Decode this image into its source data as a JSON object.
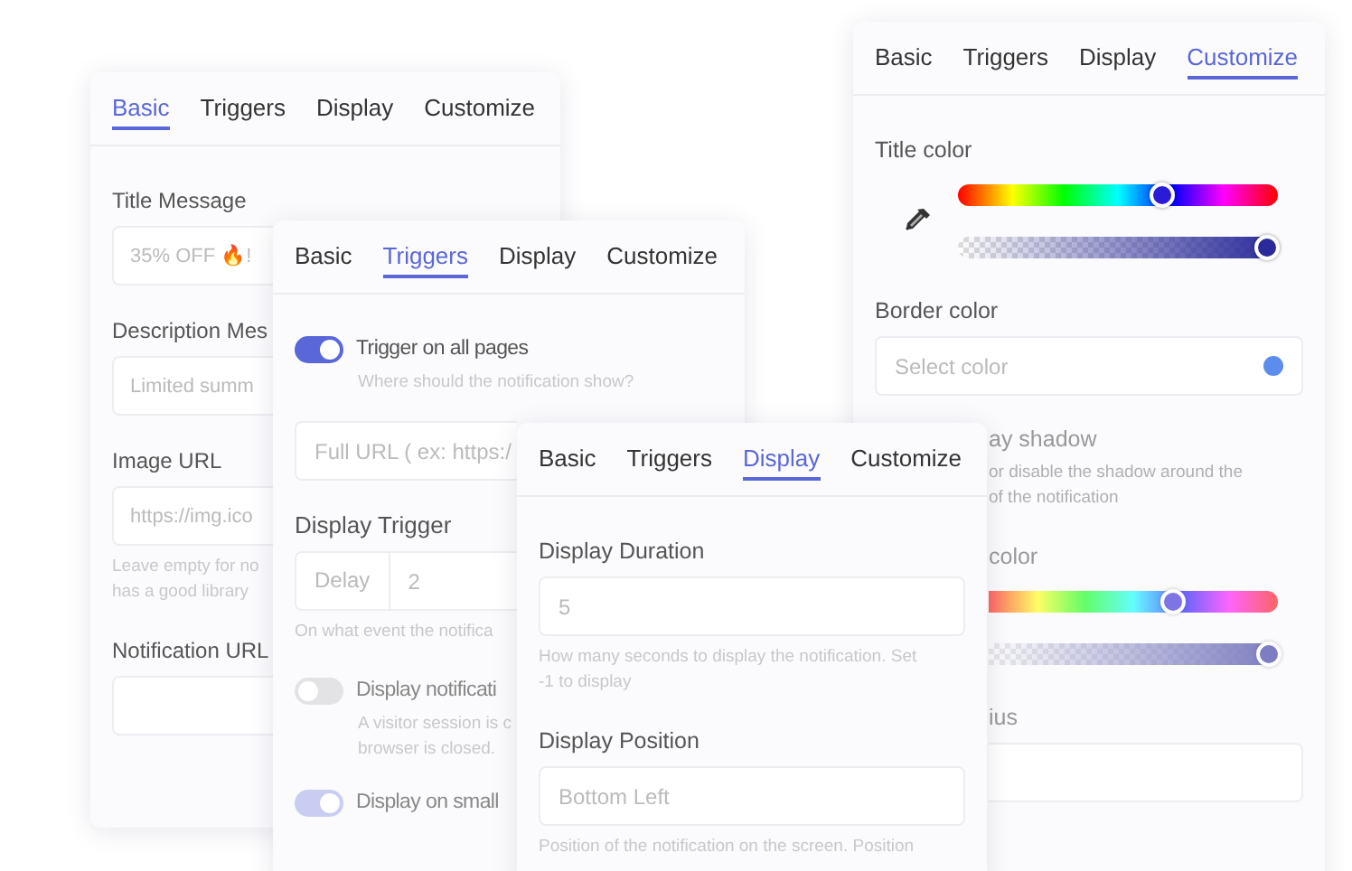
{
  "panels": [
    {
      "tabs": [
        {
          "label": "Basic",
          "selected": true
        },
        {
          "label": "Triggers",
          "selected": false
        },
        {
          "label": "Display",
          "selected": false
        },
        {
          "label": "Customize",
          "selected": false
        }
      ],
      "items": [
        {
          "kind": "field",
          "label": "Title Message",
          "value": "35% OFF 🔥!"
        },
        {
          "kind": "field",
          "label": "Description Mes",
          "placeholder": "Limited summ"
        },
        {
          "kind": "field",
          "label": "Image URL",
          "placeholder": "https://img.ico",
          "help": [
            "Leave empty for no",
            "has a good library"
          ]
        },
        {
          "kind": "field",
          "label": "Notification URL"
        }
      ]
    },
    {
      "tabs": [
        {
          "label": "Basic",
          "selected": false
        },
        {
          "label": "Triggers",
          "selected": true
        },
        {
          "label": "Display",
          "selected": false
        },
        {
          "label": "Customize",
          "selected": false
        }
      ],
      "items": [
        {
          "kind": "toggle",
          "on": true,
          "label": "Trigger on all pages",
          "help": [
            "Where should the notification show?"
          ]
        },
        {
          "kind": "field",
          "placeholder": "Full URL ( ex: https:/"
        },
        {
          "kind": "group",
          "label": "Display Trigger",
          "addon": "Delay",
          "value": "2",
          "help": [
            "On what event the notifica"
          ]
        },
        {
          "kind": "toggle",
          "on": false,
          "label": "Display notificati",
          "help": [
            "A visitor session is c",
            "browser is closed."
          ]
        },
        {
          "kind": "toggle",
          "on": true,
          "label": "Display on small"
        }
      ]
    },
    {
      "tabs": [
        {
          "label": "Basic",
          "selected": false
        },
        {
          "label": "Triggers",
          "selected": false
        },
        {
          "label": "Display",
          "selected": false
        },
        {
          "label": "Customize",
          "selected": true
        }
      ],
      "items": [
        {
          "kind": "picker",
          "label": "Title color",
          "sliders": [
            {
              "kind": "hue",
              "level": 0.63
            },
            {
              "kind": "alpha",
              "level": 0.96
            }
          ]
        },
        {
          "kind": "color_field",
          "label": "Border color",
          "placeholder": "Select color",
          "color": "#5b8def"
        },
        {
          "kind": "option",
          "label": "ay shadow",
          "help": [
            "or disable the shadow around the",
            "of the notification"
          ]
        },
        {
          "kind": "picker",
          "label": "color",
          "sliders": [
            {
              "kind": "hue",
              "level": 0.63
            },
            {
              "kind": "alpha",
              "level": 0.96
            }
          ]
        },
        {
          "kind": "field",
          "label": "ius"
        }
      ]
    },
    {
      "tabs": [
        {
          "label": "Basic",
          "selected": false
        },
        {
          "label": "Triggers",
          "selected": false
        },
        {
          "label": "Display",
          "selected": true
        },
        {
          "label": "Customize",
          "selected": false
        }
      ],
      "items": [
        {
          "kind": "field",
          "label": "Display Duration",
          "value": "5",
          "help": [
            "How many seconds to display the notification. Set",
            "-1 to display"
          ]
        },
        {
          "kind": "field",
          "label": "Display Position",
          "placeholder": "Bottom Left",
          "help": [
            "Position of the notification on the screen. Position"
          ]
        }
      ]
    }
  ]
}
